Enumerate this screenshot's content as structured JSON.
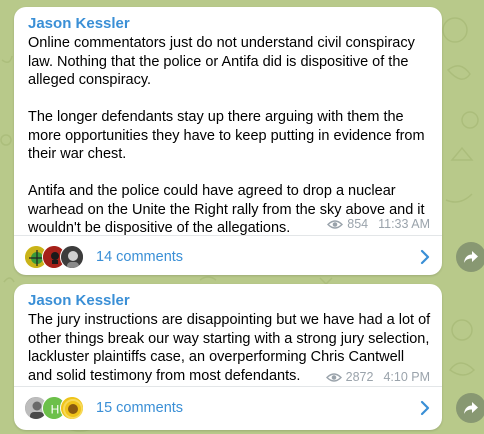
{
  "colors": {
    "background": "#b8c98a",
    "bubble": "#ffffff",
    "accent": "#3a8fd6",
    "meta": "#9aa3ab"
  },
  "posts": [
    {
      "author": "Jason Kessler",
      "text": "Online commentators just do not understand civil conspiracy law. Nothing that the police or Antifa did is dispositive of the alleged conspiracy.\n\nThe longer defendants stay up there arguing with them the more opportunities they have to keep putting in evidence from their war chest.\n\nAntifa and the police could have agreed to drop a nuclear warhead on the Unite the Right rally from the sky above and it wouldn't be dispositive of the allegations.",
      "views": "854",
      "time": "11:33 AM",
      "views_icon": "eye-icon",
      "comments_label": "14 comments",
      "share_icon": "share-arrow-icon"
    },
    {
      "author": "Jason Kessler",
      "text": "The jury instructions are disappointing but we have had a lot of other things break our way starting with a strong jury selection, lackluster plaintiffs case, an overperforming Chris Cantwell and solid testimony from most defendants.",
      "views": "2872",
      "time": "4:10 PM",
      "views_icon": "eye-icon",
      "comments_label": "15 comments",
      "avatar_letter": "H",
      "share_icon": "share-arrow-icon"
    }
  ]
}
